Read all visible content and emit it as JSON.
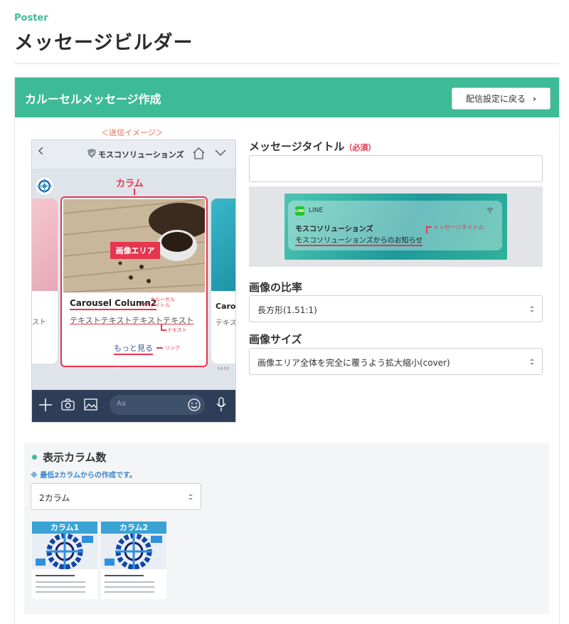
{
  "brand": "Poster",
  "page_title": "メッセージビルダー",
  "panel": {
    "title": "カルーセルメッセージ作成",
    "back_button": "配信設定に戻る"
  },
  "preview": {
    "caption": "＜送信イメージ＞",
    "account_name": "モスコソリューションズ",
    "column_label": "カラム",
    "image_area_label": "画像エリア",
    "card_title": "Carousel Column2",
    "card_title_annotation_1": "カルーセル",
    "card_title_annotation_2": "タイトル",
    "card_text": "テキストテキストテキストテキスト",
    "card_text_annotation": "テキスト",
    "card_link": "もっと見る",
    "card_link_annotation": "リンク",
    "left_card_text": "スト",
    "right_card_title": "Caro",
    "right_card_text": "テキス",
    "time": "14:03",
    "input_placeholder": "Aa"
  },
  "form": {
    "title_label": "メッセージタイトル",
    "required": "（必須）",
    "title_value": "",
    "notification": {
      "app": "LINE",
      "title": "モスコソリューションズ",
      "message": "モスコソリューションズからのお知らせ",
      "annotation": "メッセージタイトル"
    },
    "ratio_label": "画像の比率",
    "ratio_value": "長方形(1.51:1)",
    "size_label": "画像サイズ",
    "size_value": "画像エリア全体を完全に覆うよう拡大縮小(cover)"
  },
  "columns": {
    "title": "表示カラム数",
    "note": "※ 最低2カラムからの作成です。",
    "selected": "2カラム",
    "thumbs": [
      "カラム1",
      "カラム2"
    ]
  },
  "colors": {
    "accent": "#3dbb96",
    "annotation": "#e5354f",
    "thumb_header": "#3aa3d4"
  }
}
